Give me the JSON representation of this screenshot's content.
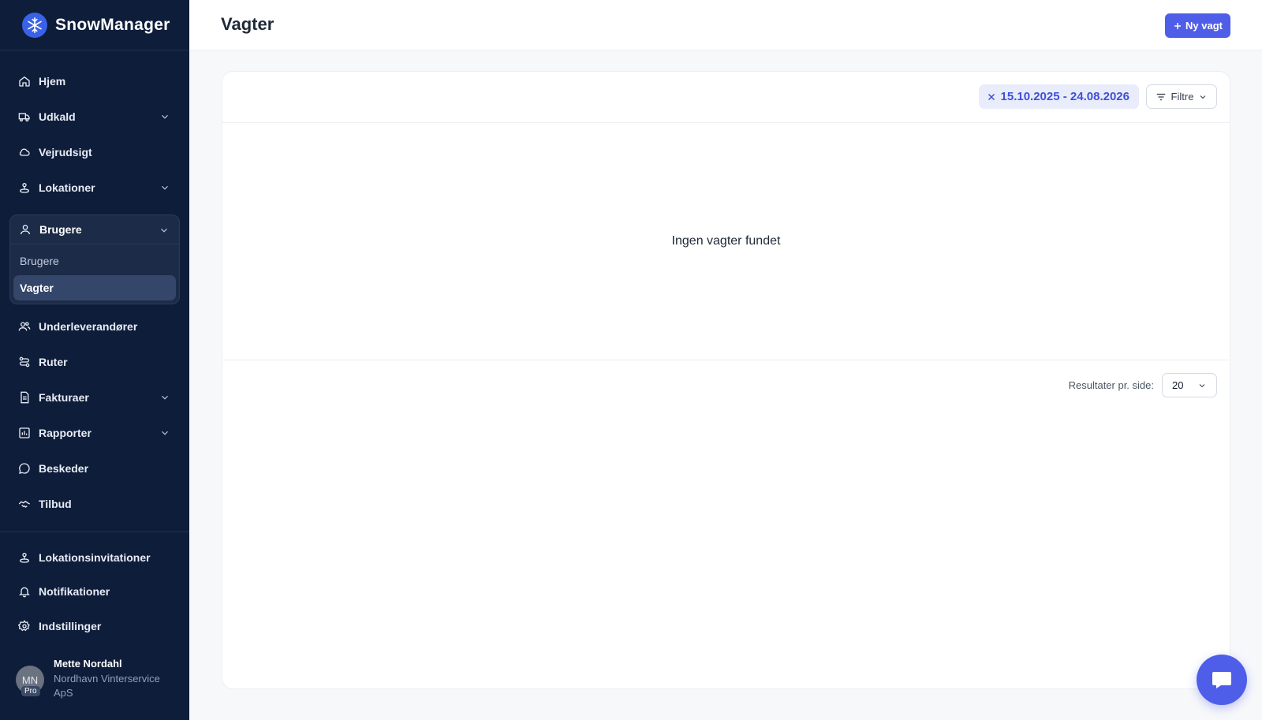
{
  "brand": {
    "name": "SnowManager"
  },
  "sidebar": {
    "items": [
      {
        "label": "Hjem",
        "icon": "home-icon"
      },
      {
        "label": "Udkald",
        "icon": "truck-icon",
        "expandable": true
      },
      {
        "label": "Vejrudsigt",
        "icon": "cloud-icon"
      },
      {
        "label": "Lokationer",
        "icon": "location-icon",
        "expandable": true
      },
      {
        "label": "Brugere",
        "icon": "user-icon",
        "expandable": true,
        "expanded": true,
        "children": [
          {
            "label": "Brugere"
          },
          {
            "label": "Vagter",
            "active": true
          }
        ]
      },
      {
        "label": "Underleverandører",
        "icon": "users-icon"
      },
      {
        "label": "Ruter",
        "icon": "route-icon"
      },
      {
        "label": "Fakturaer",
        "icon": "invoice-icon",
        "expandable": true
      },
      {
        "label": "Rapporter",
        "icon": "chart-icon",
        "expandable": true
      },
      {
        "label": "Beskeder",
        "icon": "message-icon"
      },
      {
        "label": "Tilbud",
        "icon": "handshake-icon"
      }
    ],
    "bottom_items": [
      {
        "label": "Lokationsinvitationer",
        "icon": "location-icon"
      },
      {
        "label": "Notifikationer",
        "icon": "bell-icon"
      },
      {
        "label": "Indstillinger",
        "icon": "gear-icon"
      }
    ],
    "user": {
      "initials": "MN",
      "badge": "Pro",
      "name": "Mette Nordahl",
      "company": "Nordhavn Vinterservice ApS"
    }
  },
  "header": {
    "title": "Vagter",
    "new_button": "Ny vagt"
  },
  "filters": {
    "date_range": "15.10.2025 - 24.08.2026",
    "filter_label": "Filtre"
  },
  "table": {
    "empty_message": "Ingen vagter fundet"
  },
  "pagination": {
    "per_page_label": "Resultater pr. side:",
    "per_page_value": "20"
  },
  "colors": {
    "sidebar_bg": "#0e1d3a",
    "accent": "#4f5ee8",
    "chip_bg": "#e9ecfb"
  }
}
